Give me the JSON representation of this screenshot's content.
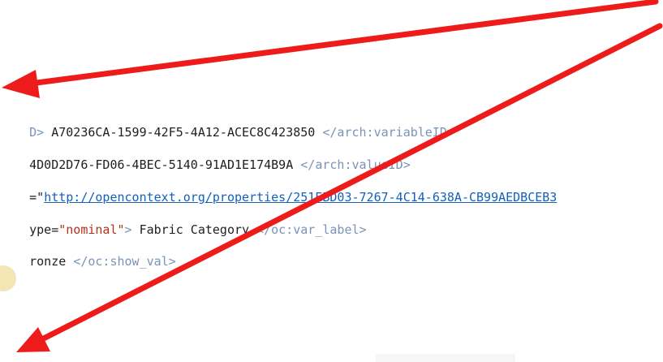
{
  "lines": [
    {
      "prefix": "D>",
      "value": " A70236CA-1599-42F5-4A12-ACEC8C423850 ",
      "close_tag": "</arch:variableID>"
    },
    {
      "value": "4D0D2D76-FD06-4BEC-5140-91AD1E174B9A ",
      "close_tag": "</arch:valueID>"
    },
    {
      "attr_fragment": "=\"",
      "link": "http://opencontext.org/properties/251EBD03-7267-4C14-638A-CB99AEDBCEB3"
    },
    {
      "attr_fragment": "ype=",
      "attr_value": "\"nominal\"",
      "tag_close": ">",
      "value": " Fabric Category ",
      "close_tag": "</oc:var_label>"
    },
    {
      "value": "ronze ",
      "close_tag": "</oc:show_val>"
    }
  ],
  "colors": {
    "arrow": "#ee1b1b",
    "tag": "#7a93b8",
    "string": "#b5311c",
    "link": "#1560b8"
  },
  "annotations": [
    "red-arrow-top",
    "red-arrow-bottom"
  ]
}
